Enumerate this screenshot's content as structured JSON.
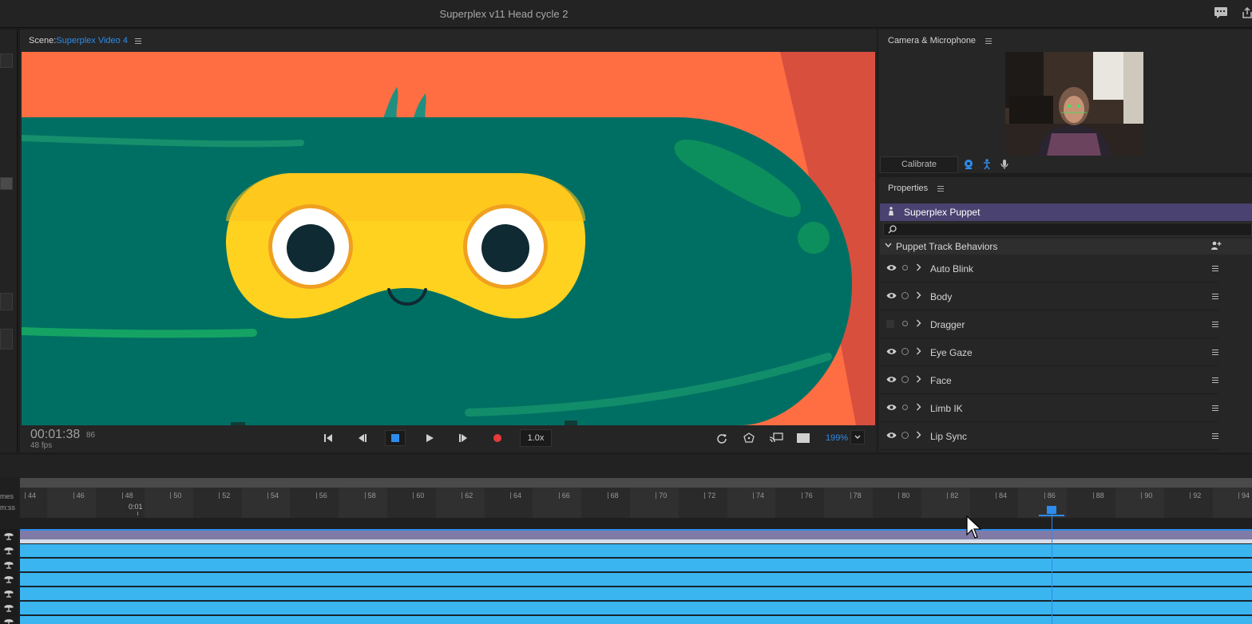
{
  "window": {
    "title": "Superplex v11 Head cycle 2"
  },
  "scene": {
    "label": "Scene:",
    "name": "Superplex Video 4",
    "timecode": "00:01:38",
    "frame": "86",
    "fps": "48 fps",
    "speed": "1.0x",
    "zoom": "199%"
  },
  "camera": {
    "title": "Camera & Microphone",
    "calibrate": "Calibrate"
  },
  "properties": {
    "title": "Properties",
    "puppet": "Superplex Puppet",
    "search_placeholder": "",
    "section": "Puppet Track Behaviors",
    "behaviors": [
      {
        "name": "Auto Blink",
        "visible": true
      },
      {
        "name": "Body",
        "visible": true
      },
      {
        "name": "Dragger",
        "visible": false
      },
      {
        "name": "Eye Gaze",
        "visible": true
      },
      {
        "name": "Face",
        "visible": true
      },
      {
        "name": "Limb IK",
        "visible": true
      },
      {
        "name": "Lip Sync",
        "visible": true
      }
    ]
  },
  "timeline": {
    "row_label_1": "mes",
    "row_label_2": "m:ss",
    "second_marker": "0:01",
    "frame_ticks": [
      "44",
      "46",
      "48",
      "50",
      "52",
      "54",
      "56",
      "58",
      "60",
      "62",
      "64",
      "66",
      "68",
      "70",
      "72",
      "74",
      "76",
      "78",
      "80",
      "82",
      "84",
      "86",
      "88",
      "90",
      "92",
      "94"
    ],
    "playhead_frame": 86
  },
  "colors": {
    "accent": "#2d8ceb",
    "stage_bg": "#ff6e43",
    "character": "#006f63",
    "mask": "#ffd21f",
    "puppet_track": "#7f7aa6",
    "behavior_track": "#3ab5f0",
    "record": "#e83a3a"
  }
}
